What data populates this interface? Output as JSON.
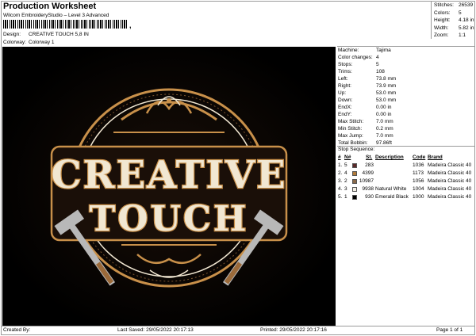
{
  "header": {
    "title": "Production Worksheet",
    "subtitle": "Wilcom EmbroideryStudio – Level 3 Advanced",
    "barcode_mark": ",",
    "design_label": "Design:",
    "design_value": "CREATIVE TOUCH 5,8 IN",
    "colorway_label": "Colorway:",
    "colorway_value": "Colorway 1"
  },
  "stats": [
    {
      "label": "Stitches:",
      "value": "26539"
    },
    {
      "label": "Colors:",
      "value": "5"
    },
    {
      "label": "Height:",
      "value": "4.18 in"
    },
    {
      "label": "Width:",
      "value": "5.82 in"
    },
    {
      "label": "Zoom:",
      "value": "1:1"
    }
  ],
  "design": {
    "line1": "CREATIVE",
    "line2": "TOUCH",
    "colors": {
      "gold": "#c8904a",
      "cream": "#f1e7d2",
      "bronze": "#9b6a3a",
      "steel": "#b8b8b8",
      "background": "#000000"
    }
  },
  "machine_info": [
    {
      "label": "Machine:",
      "value": "Tajima"
    },
    {
      "label": "Color changes:",
      "value": "4"
    },
    {
      "label": "Stops:",
      "value": "5"
    },
    {
      "label": "Trims:",
      "value": "108"
    },
    {
      "label": "Left:",
      "value": "73.8 mm"
    },
    {
      "label": "Right:",
      "value": "73.9 mm"
    },
    {
      "label": "Up:",
      "value": "53.0 mm"
    },
    {
      "label": "Down:",
      "value": "53.0 mm"
    },
    {
      "label": "EndX:",
      "value": "0.00 in"
    },
    {
      "label": "EndY:",
      "value": "0.00 in"
    },
    {
      "label": "Max Stitch:",
      "value": "7.0 mm"
    },
    {
      "label": "Min Stitch:",
      "value": "0.2 mm"
    },
    {
      "label": "Max Jump:",
      "value": "7.0 mm"
    },
    {
      "label": "Total Bobbin:",
      "value": "97.86ft"
    }
  ],
  "stop_sequence": {
    "title": "Stop Sequence:",
    "headers": {
      "num": "#",
      "n": "N#",
      "st": "St.",
      "description": "Description",
      "code": "Code",
      "brand": "Brand"
    },
    "rows": [
      {
        "num": "1.",
        "n": "5",
        "color": "#5a2a2a",
        "st": "283",
        "description": "",
        "code": "1036",
        "brand": "Madeira Classic 40"
      },
      {
        "num": "2.",
        "n": "4",
        "color": "#b07a3a",
        "st": "4399",
        "description": "",
        "code": "1173",
        "brand": "Madeira Classic 40"
      },
      {
        "num": "3.",
        "n": "2",
        "color": "#8a6a4a",
        "st": "10987",
        "description": "",
        "code": "1056",
        "brand": "Madeira Classic 40"
      },
      {
        "num": "4.",
        "n": "3",
        "color": "#f4f0e6",
        "st": "9938",
        "description": "Natural White",
        "code": "1004",
        "brand": "Madeira Classic 40"
      },
      {
        "num": "5.",
        "n": "1",
        "color": "#000000",
        "st": "930",
        "description": "Emerald Black",
        "code": "1000",
        "brand": "Madeira Classic 40"
      }
    ]
  },
  "footer": {
    "created_by": "Created By:",
    "last_saved_label": "Last Saved:",
    "last_saved_value": "29/05/2022 20:17:13",
    "printed_label": "Printed:",
    "printed_value": "29/05/2022 20:17:16",
    "page": "Page 1 of 1"
  }
}
